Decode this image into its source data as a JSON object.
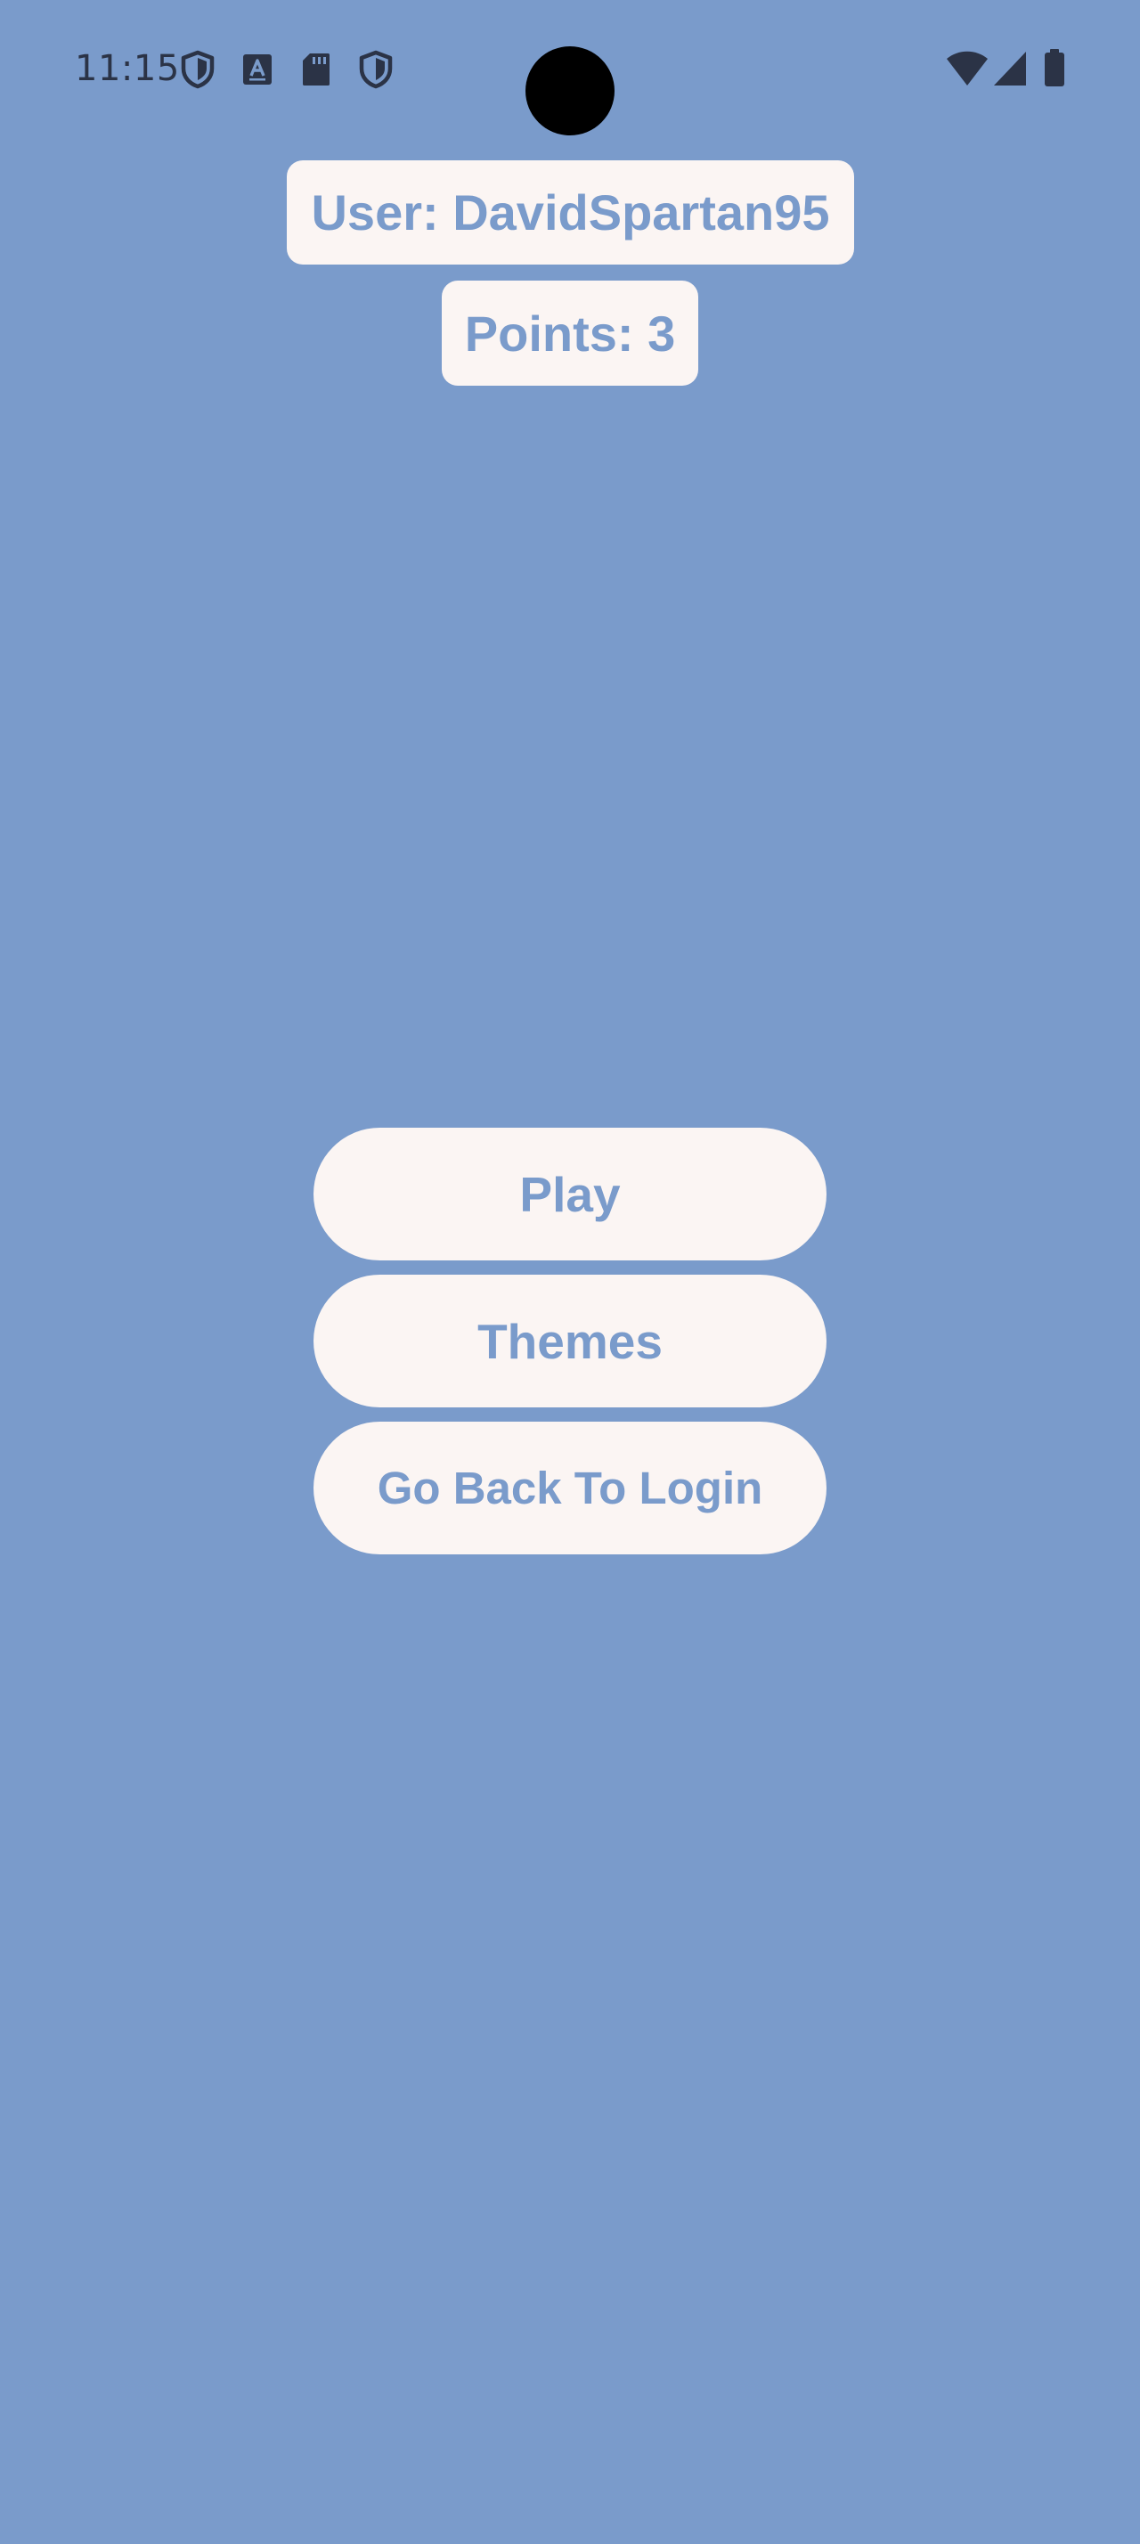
{
  "status_bar": {
    "time": "11:15",
    "left_icons": [
      "shield-icon",
      "font-a-icon",
      "sd-card-icon",
      "shield-icon"
    ],
    "right_icons": [
      "wifi-icon",
      "cellular-signal-icon",
      "battery-icon"
    ]
  },
  "header": {
    "user_label": "User: DavidSpartan95",
    "points_label": "Points: 3"
  },
  "menu": {
    "play_label": "Play",
    "themes_label": "Themes",
    "login_label": "Go Back To Login"
  },
  "colors": {
    "background": "#7a9bcb",
    "surface": "#fbf5f3",
    "accent_text": "#7a9bcb",
    "status_icons": "#2b3346"
  }
}
